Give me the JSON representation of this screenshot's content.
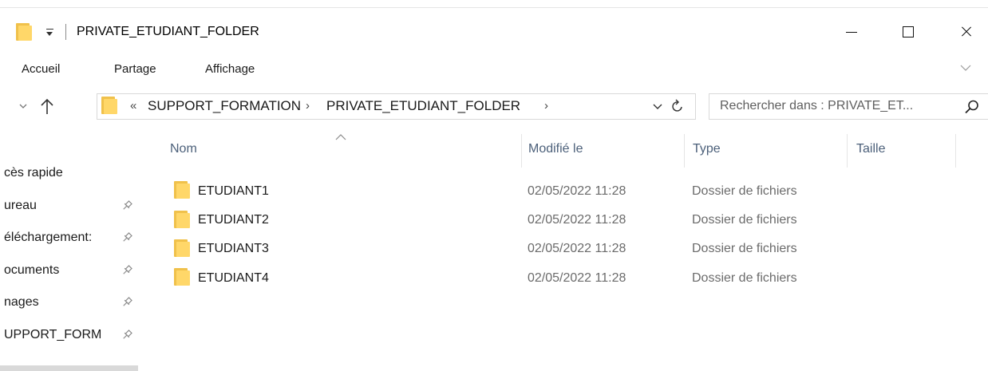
{
  "window": {
    "title": "PRIVATE_ETUDIANT_FOLDER"
  },
  "ribbon": {
    "tabs": [
      "Accueil",
      "Partage",
      "Affichage"
    ]
  },
  "address": {
    "overflow": "«",
    "segments": [
      "SUPPORT_FORMATION",
      "PRIVATE_ETUDIANT_FOLDER"
    ],
    "separator": "›"
  },
  "search": {
    "placeholder": "Rechercher dans : PRIVATE_ET..."
  },
  "nav_pane": {
    "items": [
      {
        "label": "cès rapide",
        "pinned": false
      },
      {
        "label": "ureau",
        "pinned": true
      },
      {
        "label": "éléchargement:",
        "pinned": true
      },
      {
        "label": "ocuments",
        "pinned": true
      },
      {
        "label": "nages",
        "pinned": true
      },
      {
        "label": "UPPORT_FORM",
        "pinned": true
      }
    ]
  },
  "columns": {
    "name": "Nom",
    "modified": "Modifié le",
    "type": "Type",
    "size": "Taille"
  },
  "files": [
    {
      "name": "ETUDIANT1",
      "modified": "02/05/2022 11:28",
      "type": "Dossier de fichiers",
      "size": ""
    },
    {
      "name": "ETUDIANT2",
      "modified": "02/05/2022 11:28",
      "type": "Dossier de fichiers",
      "size": ""
    },
    {
      "name": "ETUDIANT3",
      "modified": "02/05/2022 11:28",
      "type": "Dossier de fichiers",
      "size": ""
    },
    {
      "name": "ETUDIANT4",
      "modified": "02/05/2022 11:28",
      "type": "Dossier de fichiers",
      "size": ""
    }
  ],
  "colors": {
    "folder_back": "#f0c14b",
    "folder_front": "#ffd769",
    "header_text": "#4c607a",
    "secondary_text": "#6b6b6b"
  },
  "icons": {
    "title_folder": "folder-icon",
    "quick_access": "quick-access-dropdown-icon",
    "minimize": "minimize-icon",
    "maximize": "maximize-icon",
    "close": "close-icon",
    "ribbon_expand": "chevron-down-icon",
    "recent_locations": "chevron-down-icon",
    "up": "arrow-up-icon",
    "refresh": "refresh-icon",
    "search": "search-icon",
    "pin": "pin-icon",
    "sort": "sort-ascending-icon"
  }
}
